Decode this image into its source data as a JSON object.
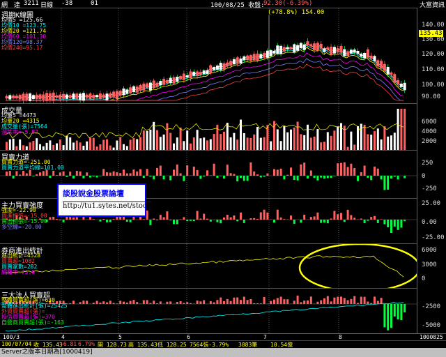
{
  "header": {
    "name": "網　達",
    "code": "3211",
    "period": "日線",
    "change": "-38",
    "num": "01",
    "date_info": "100/08/25 收盤:",
    "close_info": "92.30(-6.39%)",
    "brand": "大富資訊"
  },
  "main_chart": {
    "title": "週期K線圖",
    "peak_label": "(+78.8%) 154.00",
    "last_price": "135.43",
    "legend": [
      {
        "text": "均價5 =125.66",
        "color": "#ffffff"
      },
      {
        "text": "均價10 =123.75",
        "color": "#00ffff"
      },
      {
        "text": "均價20 =121.74",
        "color": "#ffff00"
      },
      {
        "text": "均價60 =101.30",
        "color": "#ff00ff"
      },
      {
        "text": "均價120=98.37",
        "color": "#8080ff"
      },
      {
        "text": "均價240=95.17",
        "color": "#ff4040"
      }
    ],
    "ticks": [
      "140.00",
      "130.00",
      "120.00",
      "110.00",
      "100.00",
      "90.00"
    ]
  },
  "volume": {
    "title": "成交量",
    "legend": [
      {
        "text": "均量5 =4473",
        "color": "#ffffff"
      },
      {
        "text": "均量20 =4315",
        "color": "#ffff00"
      },
      {
        "text": "成交量(張)=7564",
        "color": "#00ffff"
      },
      {
        "text": "漲跌率=-5.82",
        "color": "#ff00ff"
      }
    ],
    "ticks": [
      "6000",
      "4000",
      "2000"
    ]
  },
  "power": {
    "title": "買賣力道",
    "legend": [
      {
        "text": "買賣力道=-251.00",
        "color": "#ffff00"
      },
      {
        "text": "買賣力道平均線=101.00",
        "color": "#00ffff"
      }
    ],
    "ticks": [
      "250",
      "0",
      "-250"
    ]
  },
  "main_force": {
    "title": "主力買賣強度",
    "legend": [
      {
        "text": "強度=-22.90",
        "color": "#ffff00"
      },
      {
        "text": "買進抓張=-15.00",
        "color": "#ff4040"
      },
      {
        "text": "賣出抓張=-15.00",
        "color": "#00ff00"
      },
      {
        "text": "多空線=-20.00",
        "color": "#8080ff"
      }
    ],
    "ticks": [
      "25.00",
      "0.00",
      "-25.00"
    ]
  },
  "broker": {
    "title": "券商進出統計",
    "legend": [
      {
        "text": "進出統計=4528",
        "color": "#ffff00"
      },
      {
        "text": "買賣超=1082",
        "color": "#ff4040"
      },
      {
        "text": "買賣家數=282",
        "color": "#00ffff"
      },
      {
        "text": "網羅率=73.9",
        "color": "#ff00ff"
      }
    ],
    "ticks": [
      "6000",
      "3000",
      "0"
    ]
  },
  "institution": {
    "title": "三大法人買賣超",
    "legend": [
      {
        "text": "整體買賣超(張)=630",
        "color": "#ffff00"
      },
      {
        "text": "整體進出統計(張)=25425",
        "color": "#00ffff"
      },
      {
        "text": "外資買賣超(張)=",
        "color": "#ff4040"
      },
      {
        "text": "投信買賣超(張)=370",
        "color": "#ff00ff"
      },
      {
        "text": "自營商買賣超(張)=-163",
        "color": "#00ff00"
      }
    ],
    "ticks": [
      "-2500",
      "-5000"
    ]
  },
  "x_axis": {
    "labels": [
      "100/3",
      "4",
      "5",
      "6",
      "7",
      "8"
    ],
    "end_date": "1000825"
  },
  "info_bar": {
    "items": [
      "100/07/04",
      "收 135.43",
      "+6.81",
      "6.79%",
      "開 128.73",
      "高 135.43",
      "低 128.25",
      "7564張-3.79%",
      "3883筆",
      "10.54億"
    ]
  },
  "watermark": {
    "line1": "談股說金股票論壇",
    "line2": "http://tu1.sytes.net/stock"
  },
  "status": {
    "text": "Server之版本日期為[1000419]"
  },
  "colors": {
    "up": "#ff6060",
    "down": "#00ff40",
    "highlight": "#ffff00"
  }
}
